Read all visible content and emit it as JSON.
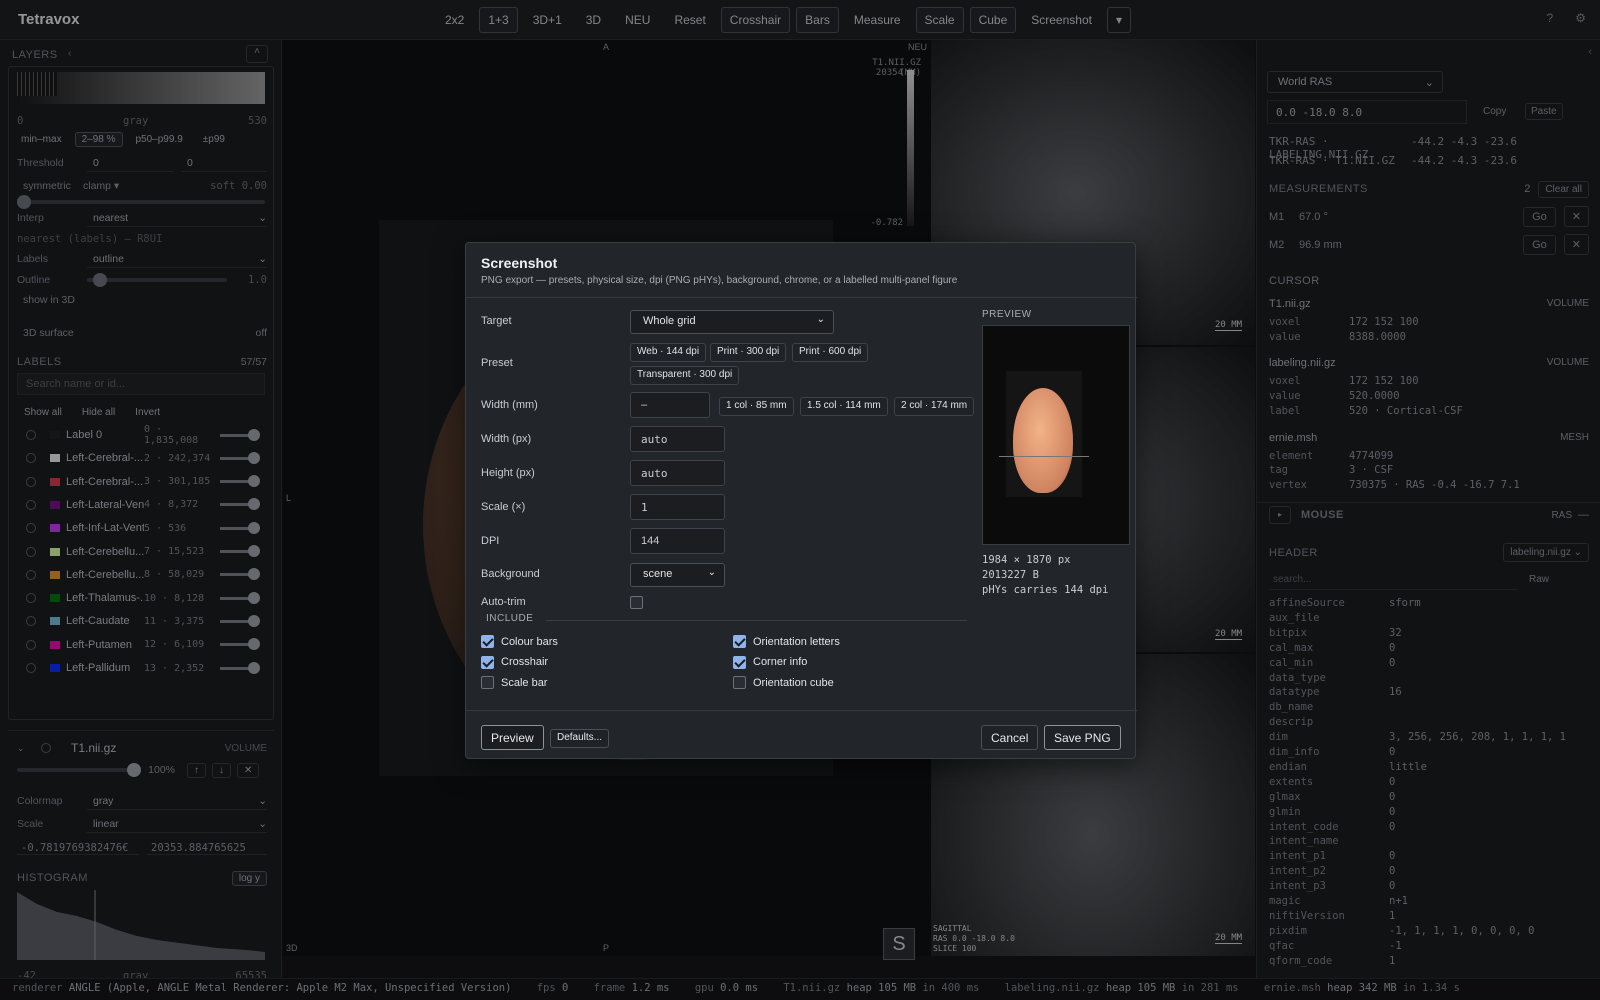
{
  "app": {
    "title": "Tetravox"
  },
  "toolbar": {
    "buttons": [
      "2x2",
      "1+3",
      "3D+1",
      "3D",
      "NEU",
      "Reset",
      "Crosshair",
      "Bars",
      "Measure",
      "Scale",
      "Cube",
      "Screenshot"
    ],
    "active": [
      "1+3",
      "Crosshair",
      "Bars",
      "Scale",
      "Cube"
    ],
    "help": "?",
    "settings": "⚙"
  },
  "layers": {
    "title": "LAYERS",
    "cmap_min": "0",
    "cmap_name": "gray",
    "cmap_max": "530",
    "range_chips": [
      "min–max",
      "2–98 %",
      "p50–p99.9",
      "±p99"
    ],
    "threshold": {
      "label": "Threshold",
      "a": "0",
      "b": "0"
    },
    "sym": {
      "label": "symmetric",
      "mode": "clamp",
      "soft": "soft 0.00"
    },
    "interp": {
      "label": "Interp",
      "value": "nearest",
      "note": "nearest (labels) — R8UI"
    },
    "labels_mode": {
      "label": "Labels",
      "value": "outline"
    },
    "outline": {
      "label": "Outline",
      "value": "1.0"
    },
    "show3d": "show in 3D",
    "surface": {
      "label": "3D surface",
      "value": "off"
    },
    "labels_title": "LABELS",
    "labels_count": "57/57",
    "search_placeholder": "Search name or id...",
    "label_actions": [
      "Show all",
      "Hide all",
      "Invert"
    ],
    "label_rows": [
      {
        "name": "Label 0",
        "count": "0 · 1,835,008",
        "color": "#222326"
      },
      {
        "name": "Left-Cerebral-...",
        "count": "2 · 242,374",
        "color": "#e8e8e8"
      },
      {
        "name": "Left-Cerebral-...",
        "count": "3 · 301,185",
        "color": "#cd3e4e"
      },
      {
        "name": "Left-Lateral-Vent...",
        "count": "4 · 8,372",
        "color": "#781286"
      },
      {
        "name": "Left-Inf-Lat-Vent",
        "count": "5 · 536",
        "color": "#c43afa"
      },
      {
        "name": "Left-Cerebellu...",
        "count": "7 · 15,523",
        "color": "#dcf8a4"
      },
      {
        "name": "Left-Cerebellu...",
        "count": "8 · 58,029",
        "color": "#e69422"
      },
      {
        "name": "Left-Thalamus-...",
        "count": "10 · 8,128",
        "color": "#00760e"
      },
      {
        "name": "Left-Caudate",
        "count": "11 · 3,375",
        "color": "#7abadc"
      },
      {
        "name": "Left-Putamen",
        "count": "12 · 6,109",
        "color": "#ec0db0"
      },
      {
        "name": "Left-Pallidum",
        "count": "13 · 2,352",
        "color": "#0c30ff"
      }
    ],
    "vol": {
      "name": "T1.nii.gz",
      "kind": "VOLUME",
      "opacity": "100%",
      "colormap_label": "Colormap",
      "colormap": "gray",
      "scale_label": "Scale",
      "scale": "linear",
      "min": "-0.7819769382476€",
      "max": "20353.884765625"
    },
    "histogram": {
      "title": "HISTOGRAM",
      "btn": "log y",
      "min": "-42",
      "name": "gray",
      "max": "65535"
    }
  },
  "viewport": {
    "main": {
      "top": "A",
      "left": "L",
      "bottom": "P",
      "corner": "3D"
    },
    "colorbar": {
      "title": "T1.NII.GZ (MM)",
      "top": "20354",
      "bottom": "-0.782"
    },
    "neu": "NEU",
    "scale": "20 MM",
    "s_button": "S",
    "sag": {
      "label": "SAGITTAL",
      "coords": "RAS 0.0 -18.0 8.0",
      "slice": "SLICE 100"
    }
  },
  "right": {
    "coord_space": "World RAS",
    "coords": "0.0 -18.0 8.0",
    "copy": "Copy",
    "paste": "Paste",
    "tkr": [
      {
        "k": "TKR-RAS · LABELING.NII.GZ",
        "v": "-44.2 -4.3 -23.6"
      },
      {
        "k": "TKR-RAS · T1.NII.GZ",
        "v": "-44.2 -4.3 -23.6"
      }
    ],
    "meas_title": "MEASUREMENTS",
    "meas_count": "2",
    "clear": "Clear all",
    "meas": [
      {
        "id": "M1",
        "v": "67.0 °"
      },
      {
        "id": "M2",
        "v": "96.9 mm"
      }
    ],
    "go": "Go",
    "cursor_title": "CURSOR",
    "cursor": [
      {
        "name": "T1.nii.gz",
        "kind": "VOLUME",
        "rows": [
          [
            "voxel",
            "172 152 100"
          ],
          [
            "value",
            "8388.0000"
          ]
        ]
      },
      {
        "name": "labeling.nii.gz",
        "kind": "VOLUME",
        "rows": [
          [
            "voxel",
            "172 152 100"
          ],
          [
            "value",
            "520.0000"
          ],
          [
            "label",
            "520 · Cortical-CSF"
          ]
        ]
      },
      {
        "name": "ernie.msh",
        "kind": "MESH",
        "rows": [
          [
            "element",
            "4774099"
          ],
          [
            "tag",
            "3 · CSF"
          ],
          [
            "vertex",
            "730375 · RAS -0.4 -16.7 7.1"
          ]
        ]
      }
    ],
    "mouse": {
      "title": "MOUSE",
      "mode": "RAS",
      "dash": "—"
    },
    "header": {
      "title": "HEADER",
      "file": "labeling.nii.gz",
      "search": "search...",
      "raw": "Raw",
      "rows": [
        [
          "affineSource",
          "sform"
        ],
        [
          "aux_file",
          ""
        ],
        [
          "bitpix",
          "32"
        ],
        [
          "cal_max",
          "0"
        ],
        [
          "cal_min",
          "0"
        ],
        [
          "data_type",
          ""
        ],
        [
          "datatype",
          "16"
        ],
        [
          "db_name",
          ""
        ],
        [
          "descrip",
          ""
        ],
        [
          "dim",
          "3, 256, 256, 208, 1, 1, 1, 1"
        ],
        [
          "dim_info",
          "0"
        ],
        [
          "endian",
          "little"
        ],
        [
          "extents",
          "0"
        ],
        [
          "glmax",
          "0"
        ],
        [
          "glmin",
          "0"
        ],
        [
          "intent_code",
          "0"
        ],
        [
          "intent_name",
          ""
        ],
        [
          "intent_p1",
          "0"
        ],
        [
          "intent_p2",
          "0"
        ],
        [
          "intent_p3",
          "0"
        ],
        [
          "magic",
          "n+1"
        ],
        [
          "niftiVersion",
          "1"
        ],
        [
          "pixdim",
          "-1, 1, 1, 1, 0, 0, 0, 0"
        ],
        [
          "qfac",
          "-1"
        ],
        [
          "qform_code",
          "1"
        ]
      ]
    }
  },
  "status": {
    "renderer": "renderer",
    "renderer_v": "ANGLE (Apple, ANGLE Metal Renderer: Apple M2 Max, Unspecified Version)",
    "fps": "fps",
    "fps_v": "0",
    "frame": "frame",
    "frame_v": "1.2 ms",
    "gpu": "gpu",
    "gpu_v": "0.0 ms",
    "t1": "T1.nii.gz",
    "t1_v": "heap 105 MB",
    "t1_t": "in 400 ms",
    "lab": "labeling.nii.gz",
    "lab_v": "heap 105 MB",
    "lab_t": "in 281 ms",
    "msh": "ernie.msh",
    "msh_v": "heap 342 MB",
    "msh_t": "in 1.34 s"
  },
  "dialog": {
    "title": "Screenshot",
    "subtitle": "PNG export — presets, physical size, dpi (PNG pHYs), background, chrome, or a labelled multi-panel figure",
    "target_label": "Target",
    "target": "Whole grid",
    "preset_label": "Preset",
    "presets": [
      "Web · 144 dpi",
      "Print · 300 dpi",
      "Print · 600 dpi",
      "Transparent · 300 dpi"
    ],
    "width_mm_label": "Width (mm)",
    "width_mm": "–",
    "col_presets": [
      "1 col · 85 mm",
      "1.5 col · 114 mm",
      "2 col · 174 mm"
    ],
    "width_px_label": "Width (px)",
    "width_px": "auto",
    "height_px_label": "Height (px)",
    "height_px": "auto",
    "scale_label": "Scale (×)",
    "scale": "1",
    "dpi_label": "DPI",
    "dpi": "144",
    "bg_label": "Background",
    "bg": "scene",
    "autotrim_label": "Auto-trim",
    "autotrim": false,
    "include_label": "INCLUDE",
    "include": [
      {
        "label": "Colour bars",
        "checked": true
      },
      {
        "label": "Orientation letters",
        "checked": true
      },
      {
        "label": "Crosshair",
        "checked": true
      },
      {
        "label": "Corner info",
        "checked": true
      },
      {
        "label": "Scale bar",
        "checked": false
      },
      {
        "label": "Orientation cube",
        "checked": false
      }
    ],
    "preview_label": "PREVIEW",
    "preview_info": [
      "1984 × 1870 px",
      "2013227 B",
      "pHYs carries 144 dpi"
    ],
    "btn_preview": "Preview",
    "btn_defaults": "Defaults...",
    "btn_cancel": "Cancel",
    "btn_save": "Save PNG"
  }
}
